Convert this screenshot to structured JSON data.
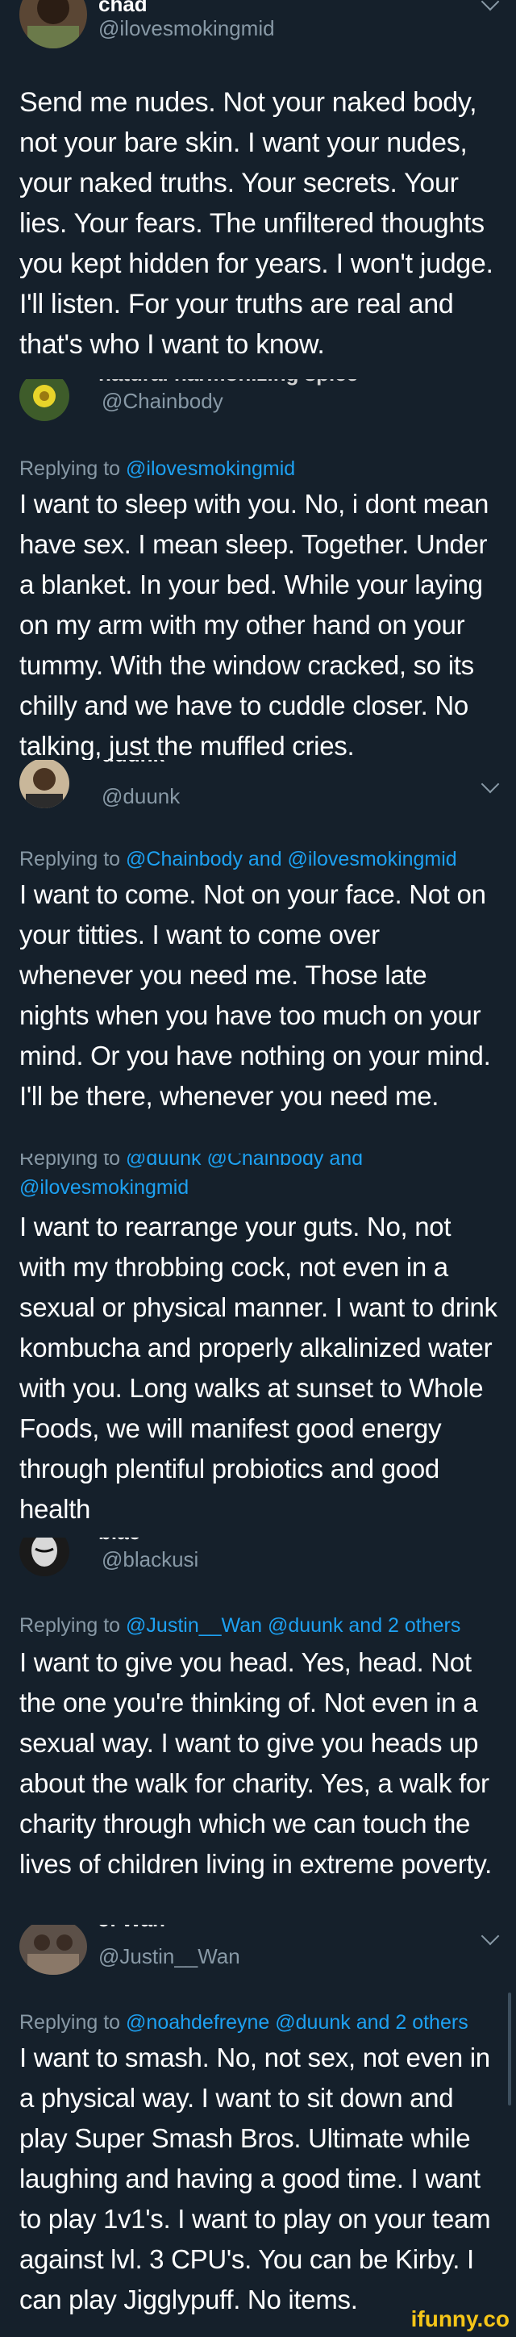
{
  "tweets": [
    {
      "name": "chad",
      "handle": "@ilovesmokingmid",
      "reply": null,
      "body": "Send me nudes. Not your naked body, not your bare skin. I want your nudes, your naked truths. Your secrets. Your lies. Your fears. The unfiltered thoughts you kept hidden for years. I won't judge. I'll listen. For your truths are real and that's who I want to know."
    },
    {
      "name": "natural harmonizing spice",
      "handle": "@Chainbody",
      "reply": {
        "prefix": "Replying to",
        "mentions": "@ilovesmokingmid"
      },
      "body": "I want to sleep with you. No, i dont mean have sex. I mean sleep. Together. Under a blanket. In your bed. While your laying on my arm with my other hand on your tummy. With the window cracked, so its chilly and we have to cuddle closer. No talking, just the muffled cries."
    },
    {
      "name": "duunk",
      "handle": "@duunk",
      "reply": {
        "prefix": "Replying to",
        "mentions": "@Chainbody and @ilovesmokingmid"
      },
      "body": "I want to come. Not on your face. Not on your titties. I want to come over whenever you need me. Those late nights when you have too much on your mind. Or you have nothing on your mind. I'll be there, whenever you need me."
    },
    {
      "name": "",
      "handle": "",
      "reply": {
        "prefix": "Replying to",
        "mentions": "@duunk @Chainbody and @ilovesmokingmid"
      },
      "body": "I want to rearrange your guts. No, not with my throbbing cock, not even in a sexual or physical manner. I want to drink kombucha and properly alkalinized water with you. Long walks at sunset to Whole Foods, we will manifest good energy through plentiful probiotics and good health"
    },
    {
      "name": "blac",
      "handle": "@blackusi",
      "reply": {
        "prefix": "Replying to",
        "mentions": "@Justin__Wan @duunk and 2 others"
      },
      "body": "I want to give you head. Yes, head. Not the one you're thinking of. Not even in a sexual way. I want to give you heads up about the walk for charity. Yes, a walk for charity through which we can touch the lives of children living in extreme poverty."
    },
    {
      "name": "J. Wan",
      "handle": "@Justin__Wan",
      "reply": {
        "prefix": "Replying to",
        "mentions": "@noahdefreyne @duunk and 2 others"
      },
      "body": "I want to smash. No, not sex, not even in a physical way. I want to sit down and play Super Smash Bros. Ultimate while laughing and having a good time. I want to play 1v1's. I want to play on your team against lvl. 3 CPU's. You can be Kirby. I can play Jigglypuff. No items."
    }
  ],
  "watermark": "ifunny.co",
  "colors": {
    "background": "#15202b",
    "muted": "#8899a6",
    "link": "#1da1f2",
    "text": "#ffffff"
  }
}
